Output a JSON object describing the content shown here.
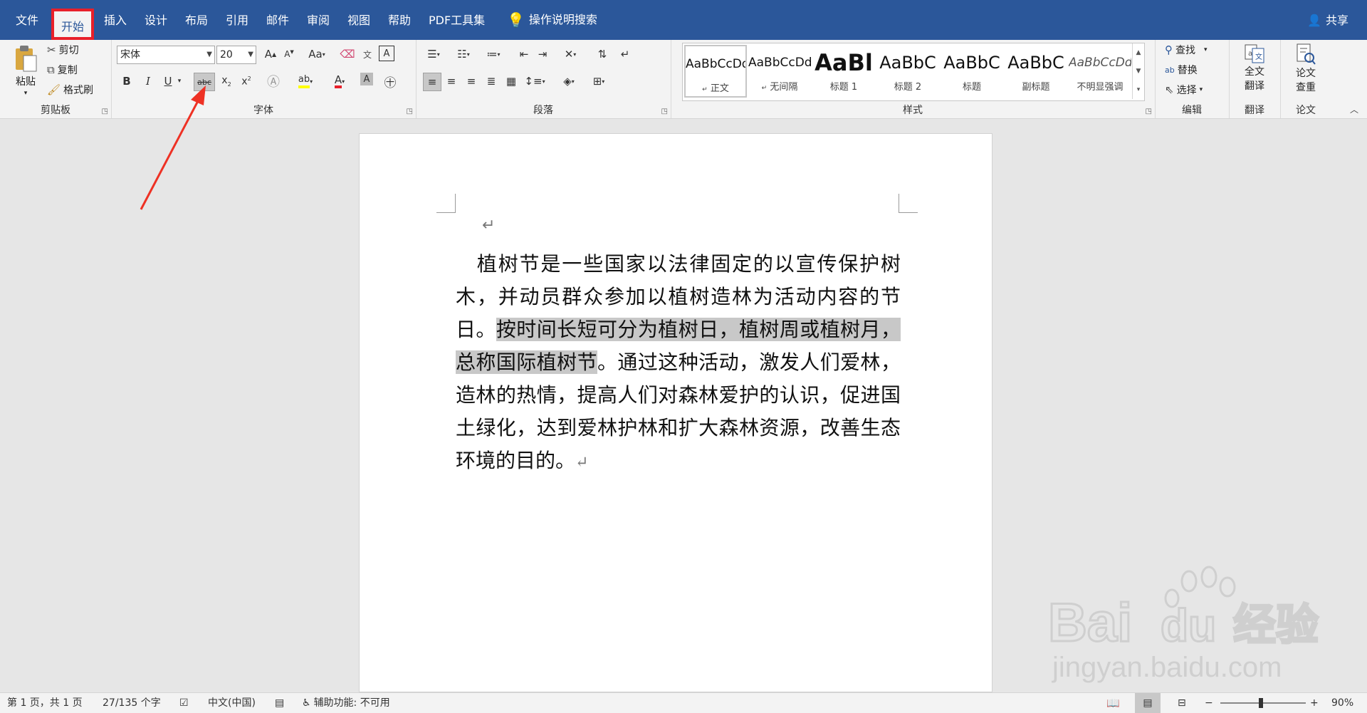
{
  "tabs": [
    "文件",
    "开始",
    "插入",
    "设计",
    "布局",
    "引用",
    "邮件",
    "审阅",
    "视图",
    "帮助",
    "PDF工具集"
  ],
  "search": "操作说明搜索",
  "share": "共享",
  "clipboard": {
    "paste": "粘贴",
    "cut": "剪切",
    "copy": "复制",
    "painter": "格式刷",
    "label": "剪贴板"
  },
  "font": {
    "name": "宋体",
    "size": "20",
    "label": "字体",
    "bold": "B",
    "italic": "I",
    "underline": "U",
    "strike": "abc",
    "grow": "A",
    "case": "Aa"
  },
  "paragraph": {
    "label": "段落"
  },
  "styles": {
    "label": "样式",
    "items": [
      {
        "preview": "AaBbCcDd",
        "name": "正文"
      },
      {
        "preview": "AaBbCcDd",
        "name": "无间隔"
      },
      {
        "preview": "AaBl",
        "name": "标题 1"
      },
      {
        "preview": "AaBbC",
        "name": "标题 2"
      },
      {
        "preview": "AaBbC",
        "name": "标题"
      },
      {
        "preview": "AaBbC",
        "name": "副标题"
      },
      {
        "preview": "AaBbCcDd",
        "name": "不明显强调"
      }
    ]
  },
  "editing": {
    "find": "查找",
    "replace": "替换",
    "select": "选择",
    "label": "编辑"
  },
  "translate": {
    "line1": "全文",
    "line2": "翻译",
    "label": "翻译"
  },
  "paper": {
    "line1": "论文",
    "line2": "查重",
    "label": "论文"
  },
  "document": {
    "before": "植树节是一些国家以法律固定的以宣传保护树木，并动员群众参加以植树造林为活动内容的节日。",
    "highlighted": "按时间长短可分为植树日，植树周或植树月，总称国际植树节",
    "after": "。通过这种活动，激发人们爱林，造林的热情，提高人们对森林爱护的认识，促进国土绿化，达到爱林护林和扩大森林资源，改善生态环境的目的。"
  },
  "status": {
    "page": "第 1 页，共 1 页",
    "words": "27/135 个字",
    "lang": "中文(中国)",
    "access": "辅助功能: 不可用",
    "zoom": "90%"
  },
  "watermark": {
    "brand": "Bai",
    "brand2": "du",
    "cn": "经验",
    "url": "jingyan.baidu.com"
  },
  "colors": {
    "tabbar": "#2b579a",
    "ribbon": "#f3f3f3",
    "highlight_box": "#e8202a",
    "arrow": "#ee3124",
    "selection": "#c8c8c8"
  }
}
